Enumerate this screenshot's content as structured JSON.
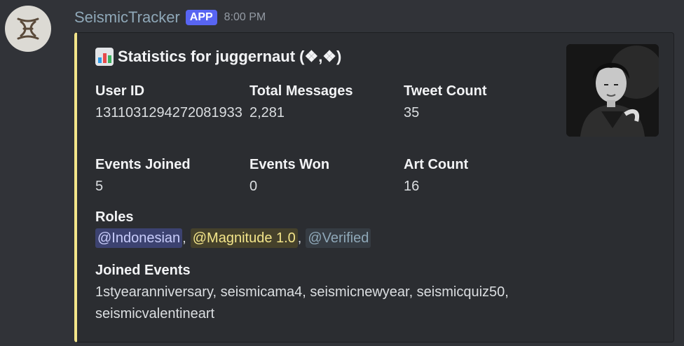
{
  "bot": {
    "name": "SeismicTracker",
    "badge": "APP",
    "time": "8:00 PM",
    "avatar_icon": "seismic-logo-icon"
  },
  "embed": {
    "accent_color": "#f3e58a",
    "title_icon": "bar-chart-icon",
    "title": "Statistics for juggernaut (❖,❖)",
    "fields": {
      "user_id": {
        "name": "User ID",
        "value": "1311031294272081933"
      },
      "total_messages": {
        "name": "Total Messages",
        "value": "2,281"
      },
      "tweet_count": {
        "name": "Tweet Count",
        "value": "35"
      },
      "events_joined": {
        "name": "Events Joined",
        "value": "5"
      },
      "events_won": {
        "name": "Events Won",
        "value": "0"
      },
      "art_count": {
        "name": "Art Count",
        "value": "16"
      }
    },
    "roles": {
      "name": "Roles",
      "items": [
        {
          "label": "@Indonesian",
          "color": "#c9cdfb",
          "bg": "#3c4270"
        },
        {
          "label": "@Magnitude 1.0",
          "color": "#f3e58a",
          "bg": "#45412b"
        },
        {
          "label": "@Verified",
          "color": "#8fa8b8",
          "bg": "#363c43"
        }
      ]
    },
    "joined_events": {
      "name": "Joined Events",
      "value": "1styearanniversary, seismicama4, seismicnewyear, seismicquiz50, seismicvalentineart"
    },
    "thumbnail_icon": "anime-character-avatar"
  }
}
